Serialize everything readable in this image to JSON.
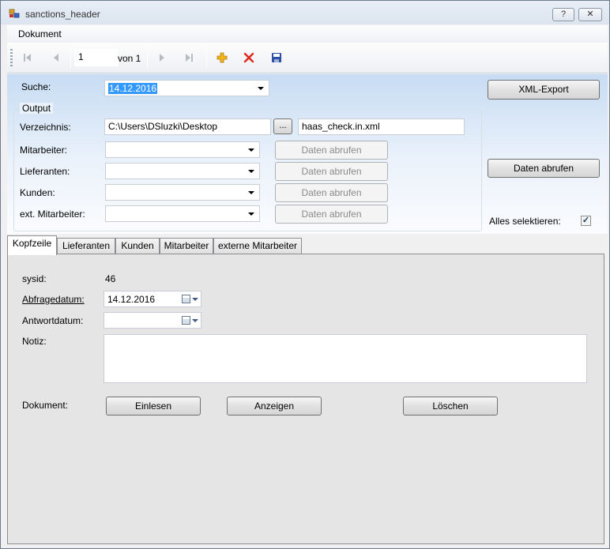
{
  "window": {
    "title": "sanctions_header",
    "help_button": "?",
    "close_button": "✕"
  },
  "menu": {
    "items": [
      "Dokument"
    ]
  },
  "navigator": {
    "position": "1",
    "count_label": "von 1"
  },
  "search": {
    "label": "Suche:",
    "value": "14.12.2016"
  },
  "xml_export_button": "XML-Export",
  "output": {
    "legend": "Output",
    "directory_label": "Verzeichnis:",
    "directory_value": "C:\\Users\\DSluzki\\Desktop",
    "browse_button": "...",
    "filename_value": "haas_check.in.xml",
    "rows": [
      {
        "label": "Mitarbeiter:",
        "value": "",
        "button": "Daten abrufen"
      },
      {
        "label": "Lieferanten:",
        "value": "",
        "button": "Daten abrufen"
      },
      {
        "label": "Kunden:",
        "value": "",
        "button": "Daten abrufen"
      },
      {
        "label": "ext. Mitarbeiter:",
        "value": "",
        "button": "Daten abrufen"
      }
    ]
  },
  "fetch_all_button": "Daten abrufen",
  "select_all": {
    "label": "Alles selektieren:",
    "checked": true,
    "mark": "✓"
  },
  "tabs": [
    "Kopfzeile",
    "Lieferanten",
    "Kunden",
    "Mitarbeiter",
    "externe Mitarbeiter"
  ],
  "header_tab": {
    "sysid_label": "sysid:",
    "sysid_value": "46",
    "query_date_label": "Abfragedatum:",
    "query_date_value": "14.12.2016",
    "answer_date_label": "Antwortdatum:",
    "answer_date_value": "",
    "notes_label": "Notiz:",
    "notes_value": "",
    "document_label": "Dokument:",
    "read_button": "Einlesen",
    "show_button": "Anzeigen",
    "delete_button": "Löschen"
  },
  "colors": {
    "selection": "#3399ff",
    "delete_icon": "#e0261c",
    "add_icon": "#f2b418",
    "save_icon": "#2d4fa3"
  }
}
